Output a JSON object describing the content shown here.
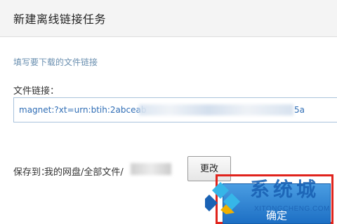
{
  "dialog": {
    "title": "新建离线链接任务",
    "hint": "填写要下载的文件链接",
    "link_label": "文件链接：",
    "link_value": "magnet:?xt=urn:btih:2abceab",
    "link_value_tail": "5a",
    "save_label": "保存到：",
    "save_path": "我的网盘/全部文件/",
    "change_button": "更改",
    "confirm_button": "确定"
  },
  "watermark": {
    "text": "系统城",
    "url": "XITONGCHENG.COM"
  },
  "colors": {
    "accent": "#1d6fc4",
    "highlight": "#e0231c",
    "link": "#2f6db5",
    "hint": "#6a8fb0"
  }
}
